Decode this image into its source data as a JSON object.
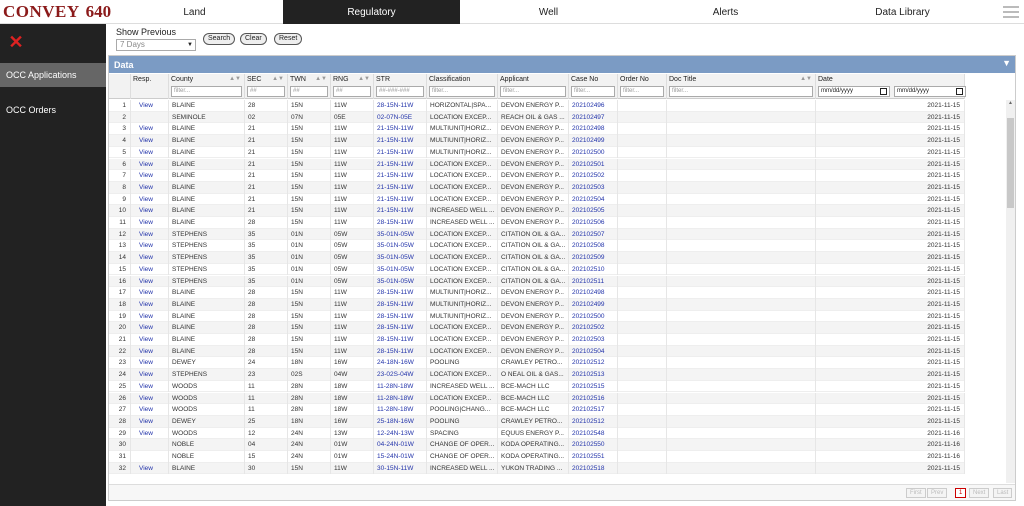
{
  "brand": {
    "name": "CONVEY",
    "number": "640"
  },
  "nav": {
    "tabs": [
      "Land",
      "Regulatory",
      "Well",
      "Alerts",
      "Data Library"
    ],
    "active_index": 1
  },
  "sidebar": {
    "close_symbol": "✕",
    "items": [
      "OCC Applications",
      "OCC Orders"
    ],
    "active_index": 0
  },
  "filters": {
    "show_previous_label": "Show Previous",
    "show_previous_value": "7 Days",
    "buttons": [
      "Search",
      "Clear",
      "Reset"
    ]
  },
  "panel": {
    "title": "Data",
    "toggle_symbol": "▼"
  },
  "table": {
    "columns": [
      "",
      "Resp.",
      "County",
      "SEC",
      "TWN",
      "RNG",
      "STR",
      "Classification",
      "Applicant",
      "Case No",
      "Order No",
      "Doc Title",
      "Date"
    ],
    "filter_placeholders": [
      "",
      "",
      "filter...",
      "##",
      "##",
      "##",
      "##-###-###",
      "filter...",
      "filter...",
      "filter...",
      "filter...",
      "filter...",
      ""
    ],
    "date_placeholders": [
      "mm/dd/yyyy",
      "mm/dd/yyyy"
    ],
    "rows": [
      [
        "1",
        "View",
        "BLAINE",
        "28",
        "15N",
        "11W",
        "28-15N-11W",
        "HORIZONTAL|SPA...",
        "DEVON ENERGY P...",
        "202102496",
        "",
        "",
        "2021-11-15"
      ],
      [
        "2",
        "",
        "SEMINOLE",
        "02",
        "07N",
        "05E",
        "02-07N-05E",
        "LOCATION EXCEP...",
        "REACH OIL & GAS ...",
        "202102497",
        "",
        "",
        "2021-11-15"
      ],
      [
        "3",
        "View",
        "BLAINE",
        "21",
        "15N",
        "11W",
        "21-15N-11W",
        "MULTIUNIT|HORIZ...",
        "DEVON ENERGY P...",
        "202102498",
        "",
        "",
        "2021-11-15"
      ],
      [
        "4",
        "View",
        "BLAINE",
        "21",
        "15N",
        "11W",
        "21-15N-11W",
        "MULTIUNIT|HORIZ...",
        "DEVON ENERGY P...",
        "202102499",
        "",
        "",
        "2021-11-15"
      ],
      [
        "5",
        "View",
        "BLAINE",
        "21",
        "15N",
        "11W",
        "21-15N-11W",
        "MULTIUNIT|HORIZ...",
        "DEVON ENERGY P...",
        "202102500",
        "",
        "",
        "2021-11-15"
      ],
      [
        "6",
        "View",
        "BLAINE",
        "21",
        "15N",
        "11W",
        "21-15N-11W",
        "LOCATION EXCEP...",
        "DEVON ENERGY P...",
        "202102501",
        "",
        "",
        "2021-11-15"
      ],
      [
        "7",
        "View",
        "BLAINE",
        "21",
        "15N",
        "11W",
        "21-15N-11W",
        "LOCATION EXCEP...",
        "DEVON ENERGY P...",
        "202102502",
        "",
        "",
        "2021-11-15"
      ],
      [
        "8",
        "View",
        "BLAINE",
        "21",
        "15N",
        "11W",
        "21-15N-11W",
        "LOCATION EXCEP...",
        "DEVON ENERGY P...",
        "202102503",
        "",
        "",
        "2021-11-15"
      ],
      [
        "9",
        "View",
        "BLAINE",
        "21",
        "15N",
        "11W",
        "21-15N-11W",
        "LOCATION EXCEP...",
        "DEVON ENERGY P...",
        "202102504",
        "",
        "",
        "2021-11-15"
      ],
      [
        "10",
        "View",
        "BLAINE",
        "21",
        "15N",
        "11W",
        "21-15N-11W",
        "INCREASED WELL ...",
        "DEVON ENERGY P...",
        "202102505",
        "",
        "",
        "2021-11-15"
      ],
      [
        "11",
        "View",
        "BLAINE",
        "28",
        "15N",
        "11W",
        "28-15N-11W",
        "INCREASED WELL ...",
        "DEVON ENERGY P...",
        "202102506",
        "",
        "",
        "2021-11-15"
      ],
      [
        "12",
        "View",
        "STEPHENS",
        "35",
        "01N",
        "05W",
        "35-01N-05W",
        "LOCATION EXCEP...",
        "CITATION OIL & GA...",
        "202102507",
        "",
        "",
        "2021-11-15"
      ],
      [
        "13",
        "View",
        "STEPHENS",
        "35",
        "01N",
        "05W",
        "35-01N-05W",
        "LOCATION EXCEP...",
        "CITATION OIL & GA...",
        "202102508",
        "",
        "",
        "2021-11-15"
      ],
      [
        "14",
        "View",
        "STEPHENS",
        "35",
        "01N",
        "05W",
        "35-01N-05W",
        "LOCATION EXCEP...",
        "CITATION OIL & GA...",
        "202102509",
        "",
        "",
        "2021-11-15"
      ],
      [
        "15",
        "View",
        "STEPHENS",
        "35",
        "01N",
        "05W",
        "35-01N-05W",
        "LOCATION EXCEP...",
        "CITATION OIL & GA...",
        "202102510",
        "",
        "",
        "2021-11-15"
      ],
      [
        "16",
        "View",
        "STEPHENS",
        "35",
        "01N",
        "05W",
        "35-01N-05W",
        "LOCATION EXCEP...",
        "CITATION OIL & GA...",
        "202102511",
        "",
        "",
        "2021-11-15"
      ],
      [
        "17",
        "View",
        "BLAINE",
        "28",
        "15N",
        "11W",
        "28-15N-11W",
        "MULTIUNIT|HORIZ...",
        "DEVON ENERGY P...",
        "202102498",
        "",
        "",
        "2021-11-15"
      ],
      [
        "18",
        "View",
        "BLAINE",
        "28",
        "15N",
        "11W",
        "28-15N-11W",
        "MULTIUNIT|HORIZ...",
        "DEVON ENERGY P...",
        "202102499",
        "",
        "",
        "2021-11-15"
      ],
      [
        "19",
        "View",
        "BLAINE",
        "28",
        "15N",
        "11W",
        "28-15N-11W",
        "MULTIUNIT|HORIZ...",
        "DEVON ENERGY P...",
        "202102500",
        "",
        "",
        "2021-11-15"
      ],
      [
        "20",
        "View",
        "BLAINE",
        "28",
        "15N",
        "11W",
        "28-15N-11W",
        "LOCATION EXCEP...",
        "DEVON ENERGY P...",
        "202102502",
        "",
        "",
        "2021-11-15"
      ],
      [
        "21",
        "View",
        "BLAINE",
        "28",
        "15N",
        "11W",
        "28-15N-11W",
        "LOCATION EXCEP...",
        "DEVON ENERGY P...",
        "202102503",
        "",
        "",
        "2021-11-15"
      ],
      [
        "22",
        "View",
        "BLAINE",
        "28",
        "15N",
        "11W",
        "28-15N-11W",
        "LOCATION EXCEP...",
        "DEVON ENERGY P...",
        "202102504",
        "",
        "",
        "2021-11-15"
      ],
      [
        "23",
        "View",
        "DEWEY",
        "24",
        "18N",
        "16W",
        "24-18N-16W",
        "POOLING",
        "CRAWLEY PETRO...",
        "202102512",
        "",
        "",
        "2021-11-15"
      ],
      [
        "24",
        "View",
        "STEPHENS",
        "23",
        "02S",
        "04W",
        "23-02S-04W",
        "LOCATION EXCEP...",
        "O NEAL OIL & GAS...",
        "202102513",
        "",
        "",
        "2021-11-15"
      ],
      [
        "25",
        "View",
        "WOODS",
        "11",
        "28N",
        "18W",
        "11-28N-18W",
        "INCREASED WELL ...",
        "BCE-MACH LLC",
        "202102515",
        "",
        "",
        "2021-11-15"
      ],
      [
        "26",
        "View",
        "WOODS",
        "11",
        "28N",
        "18W",
        "11-28N-18W",
        "LOCATION EXCEP...",
        "BCE-MACH LLC",
        "202102516",
        "",
        "",
        "2021-11-15"
      ],
      [
        "27",
        "View",
        "WOODS",
        "11",
        "28N",
        "18W",
        "11-28N-18W",
        "POOLING|CHANG...",
        "BCE-MACH LLC",
        "202102517",
        "",
        "",
        "2021-11-15"
      ],
      [
        "28",
        "View",
        "DEWEY",
        "25",
        "18N",
        "16W",
        "25-18N-16W",
        "POOLING",
        "CRAWLEY PETRO...",
        "202102512",
        "",
        "",
        "2021-11-15"
      ],
      [
        "29",
        "View",
        "WOODS",
        "12",
        "24N",
        "13W",
        "12-24N-13W",
        "SPACING",
        "EQUUS ENERGY P...",
        "202102548",
        "",
        "",
        "2021-11-16"
      ],
      [
        "30",
        "",
        "NOBLE",
        "04",
        "24N",
        "01W",
        "04-24N-01W",
        "CHANGE OF OPER...",
        "KODA OPERATING...",
        "202102550",
        "",
        "",
        "2021-11-16"
      ],
      [
        "31",
        "",
        "NOBLE",
        "15",
        "24N",
        "01W",
        "15-24N-01W",
        "CHANGE OF OPER...",
        "KODA OPERATING...",
        "202102551",
        "",
        "",
        "2021-11-16"
      ],
      [
        "32",
        "View",
        "BLAINE",
        "30",
        "15N",
        "11W",
        "30-15N-11W",
        "INCREASED WELL ...",
        "YUKON TRADING ...",
        "202102518",
        "",
        "",
        "2021-11-15"
      ]
    ]
  },
  "pager": {
    "buttons": [
      "First",
      "Prev",
      "1",
      "Next",
      "Last"
    ],
    "current_index": 2
  }
}
